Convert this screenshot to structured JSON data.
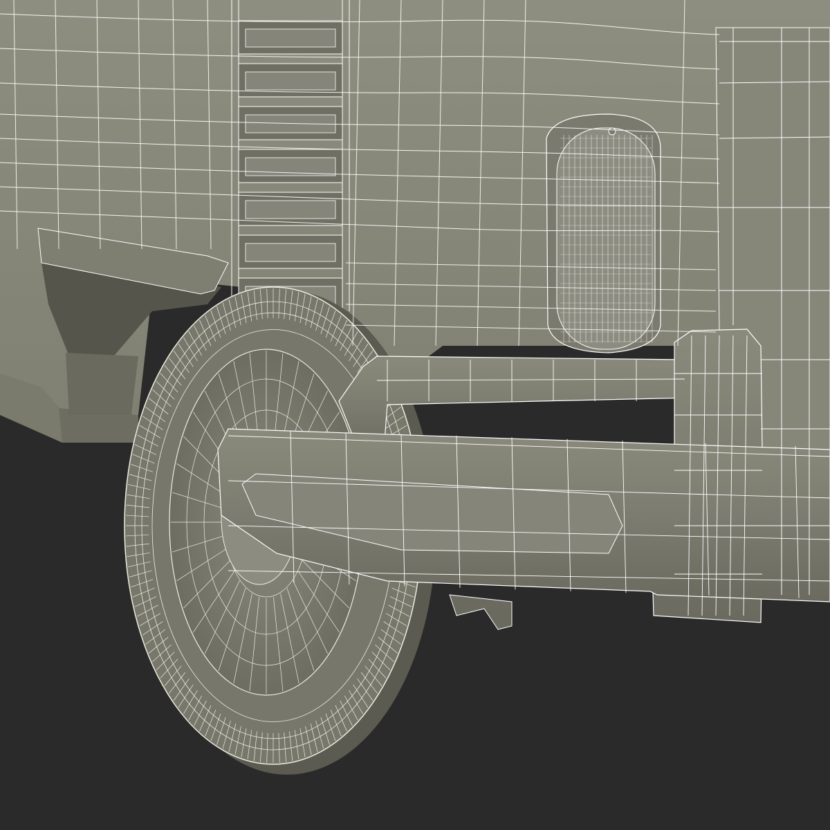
{
  "colors": {
    "background": "#2a2a2a",
    "body_fill": "#8b8b7d",
    "body_dark": "#6f6f63",
    "body_shadow": "#55554b",
    "wire": "#ffffff",
    "tire_wire": "#efeee0"
  }
}
